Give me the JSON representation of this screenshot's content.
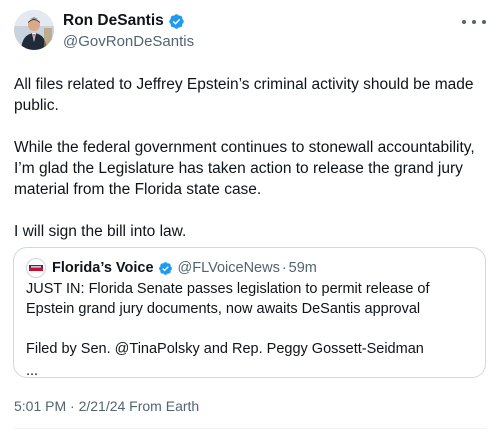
{
  "author": {
    "name": "Ron DeSantis",
    "handle": "@GovRonDeSantis",
    "avatar_icon": "portrait-avatar-icon",
    "verified_icon": "verified-badge-icon"
  },
  "tweet": {
    "paragraphs": [
      "All files related to Jeffrey Epstein’s criminal activity should be made public.",
      "While the federal government continues to stonewall accountability, I’m glad the Legislature has taken action to release the grand jury material from the Florida state case.",
      "I will sign the bill into law."
    ],
    "timestamp": "5:01 PM · 2/21/24 From Earth"
  },
  "quote": {
    "name": "Florida’s Voice",
    "handle": "@FLVoiceNews",
    "separator": "·",
    "time": "59m",
    "paragraphs": [
      "JUST IN: Florida Senate passes legislation to permit release of Epstein grand jury documents, now awaits DeSantis approval",
      "Filed by Sen. @TinaPolsky and Rep. Peggy Gossett-Seidman",
      "..."
    ]
  },
  "colors": {
    "text": "#0f1419",
    "secondary": "#536471",
    "border": "#cfd9de",
    "verified": "#1d9bf0"
  }
}
